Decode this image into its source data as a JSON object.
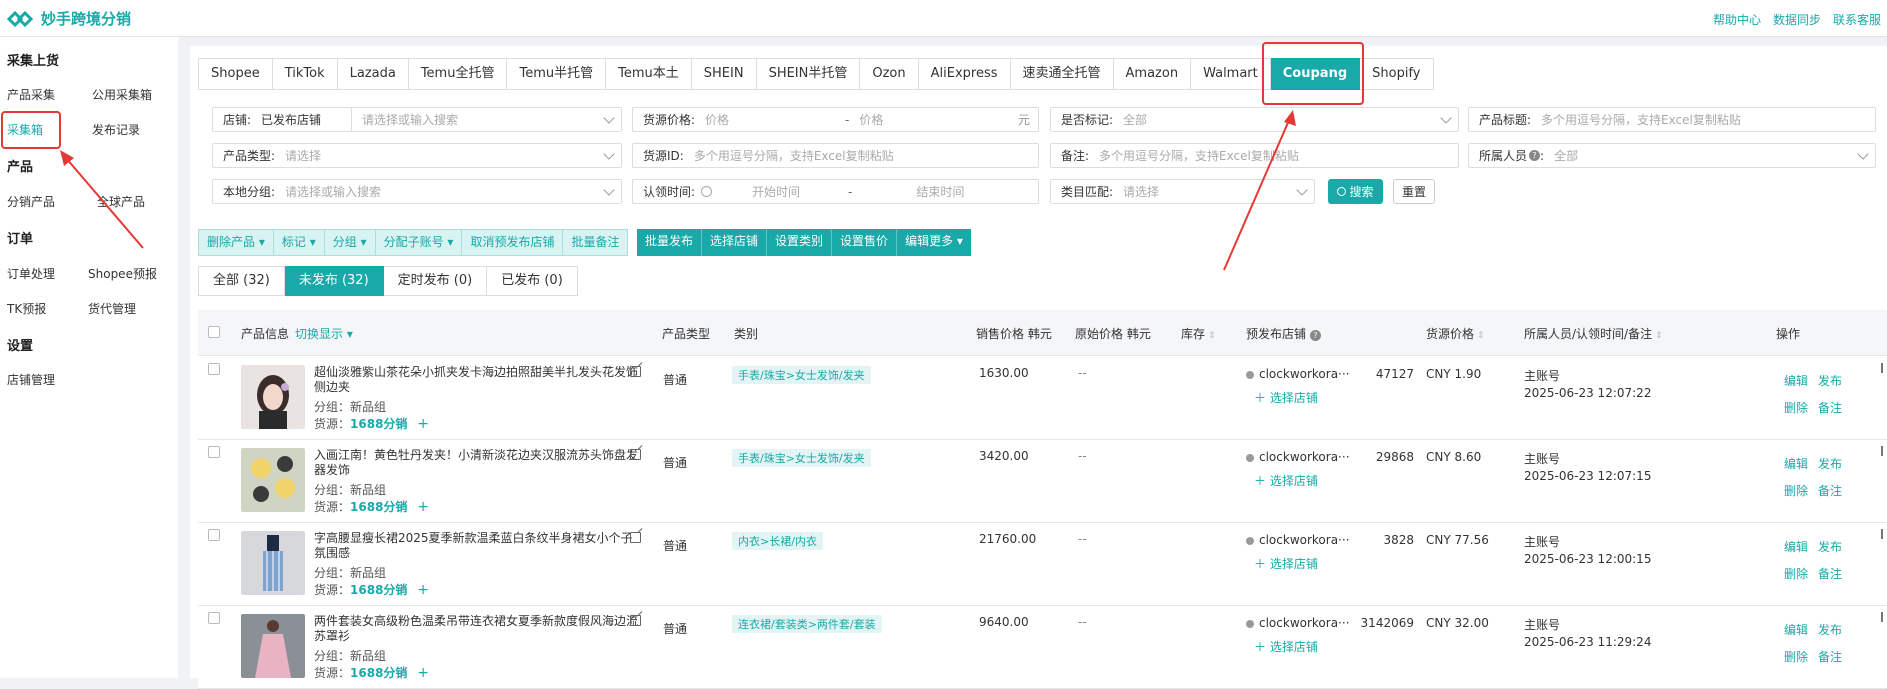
{
  "app": {
    "title": "妙手跨境分销"
  },
  "toplinks": [
    "帮助中心",
    "数据同步",
    "联系客服"
  ],
  "sidebar": {
    "sections": [
      {
        "title": "采集上货",
        "items": [
          "产品采集",
          "公用采集箱",
          "采集箱",
          "发布记录"
        ]
      },
      {
        "title": "产品",
        "items": [
          "分销产品",
          "全球产品"
        ]
      },
      {
        "title": "订单",
        "items": [
          "订单处理",
          "Shopee预报",
          "TK预报",
          "货代管理"
        ]
      },
      {
        "title": "设置",
        "items": [
          "店铺管理"
        ]
      }
    ]
  },
  "platform_tabs": [
    "Shopee",
    "TikTok",
    "Lazada",
    "Temu全托管",
    "Temu半托管",
    "Temu本土",
    "SHEIN",
    "SHEIN半托管",
    "Ozon",
    "AliExpress",
    "速卖通全托管",
    "Amazon",
    "Walmart",
    "Coupang",
    "Shopify"
  ],
  "filters": {
    "store": {
      "label": "店铺:",
      "value": "已发布店铺",
      "placeholder": "请选择或输入搜索"
    },
    "price": {
      "label": "货源价格:",
      "min_ph": "价格",
      "sep": "-",
      "max_ph": "价格",
      "unit": "元"
    },
    "marked": {
      "label": "是否标记:",
      "value": "全部"
    },
    "title": {
      "label": "产品标题:",
      "placeholder": "多个用逗号分隔，支持Excel复制粘贴"
    },
    "type": {
      "label": "产品类型:",
      "placeholder": "请选择"
    },
    "source_id": {
      "label": "货源ID:",
      "placeholder": "多个用逗号分隔，支持Excel复制粘贴"
    },
    "remark": {
      "label": "备注:",
      "placeholder": "多个用逗号分隔，支持Excel复制粘贴"
    },
    "owner": {
      "label": "所属人员",
      "value": "全部"
    },
    "group": {
      "label": "本地分组:",
      "placeholder": "请选择或输入搜索"
    },
    "claim_time": {
      "label": "认领时间:",
      "start": "开始时间",
      "sep": "-",
      "end": "结束时间"
    },
    "category": {
      "label": "类目匹配:",
      "placeholder": "请选择"
    },
    "search_btn": "搜索",
    "reset_btn": "重置"
  },
  "actions_light": [
    "删除产品",
    "标记",
    "分组",
    "分配子账号",
    "取消预发布店铺",
    "批量备注"
  ],
  "actions_dark": [
    "批量发布",
    "选择店铺",
    "设置类别",
    "设置售价",
    "编辑更多"
  ],
  "status_tabs": [
    "全部 (32)",
    "未发布 (32)",
    "定时发布 (0)",
    "已发布 (0)"
  ],
  "table": {
    "headers": {
      "info": "产品信息",
      "switch": "切换显示",
      "ptype": "产品类型",
      "category": "类别",
      "sale_price": "销售价格 韩元",
      "orig_price": "原始价格 韩元",
      "stock": "库存",
      "pre_store": "预发布店铺",
      "src_price": "货源价格",
      "owner": "所属人员/认领时间/备注",
      "ops": "操作"
    },
    "rows": [
      {
        "title": "超仙淡雅紫山茶花朵小抓夹发卡海边拍照甜美半扎发头花发饰侧边夹",
        "group": "分组：新品组",
        "source": "货源：",
        "source_link": "1688分销",
        "ptype": "普通",
        "category": "手表/珠宝>女士发饰/发夹",
        "sale": "1630.00",
        "orig": "--",
        "stock": "47127",
        "store": "clockworkora···",
        "choose": "选择店铺",
        "src_price": "CNY 1.90",
        "owner": "主账号",
        "time": "2025-06-23 12:07:22"
      },
      {
        "title": "入画江南！黄色牡丹发夹！小清新淡花边夹汉服流苏头饰盘发器发饰",
        "group": "分组：新品组",
        "source": "货源：",
        "source_link": "1688分销",
        "ptype": "普通",
        "category": "手表/珠宝>女士发饰/发夹",
        "sale": "3420.00",
        "orig": "--",
        "stock": "29868",
        "store": "clockworkora···",
        "choose": "选择店铺",
        "src_price": "CNY 8.60",
        "owner": "主账号",
        "time": "2025-06-23 12:07:15"
      },
      {
        "title": "字高腰显瘦长裙2025夏季新款温柔蓝白条纹半身裙女小个子氛围感",
        "group": "分组：新品组",
        "source": "货源：",
        "source_link": "1688分销",
        "ptype": "普通",
        "category": "内衣>长裙/内衣",
        "sale": "21760.00",
        "orig": "--",
        "stock": "3828",
        "store": "clockworkora···",
        "choose": "选择店铺",
        "src_price": "CNY 77.56",
        "owner": "主账号",
        "time": "2025-06-23 12:00:15"
      },
      {
        "title": "两件套装女高级粉色温柔吊带连衣裙女夏季新款度假风海边流苏罩衫",
        "group": "分组：新品组",
        "source": "货源：",
        "source_link": "1688分销",
        "ptype": "普通",
        "category": "连衣裙/套装类>两件套/套装",
        "sale": "9640.00",
        "orig": "--",
        "stock": "3142069",
        "store": "clockworkora···",
        "choose": "选择店铺",
        "src_price": "CNY 32.00",
        "owner": "主账号",
        "time": "2025-06-23 11:29:24"
      }
    ],
    "ops": [
      "编辑",
      "发布",
      "删除",
      "备注"
    ]
  }
}
